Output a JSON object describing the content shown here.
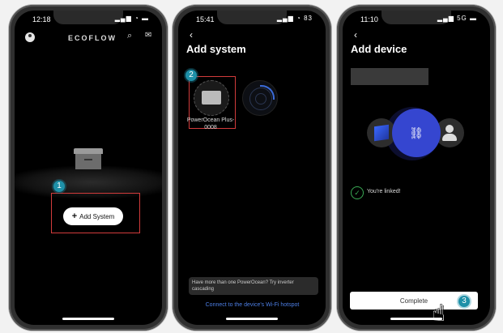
{
  "phone1": {
    "time": "12:18",
    "status": "▂▄▆ ◔ ▬",
    "logo": "ECOFLOW",
    "step_number": "1",
    "add_button": "Add System"
  },
  "phone2": {
    "time": "15:41",
    "status": "▂▄▆ ◔ 83",
    "title": "Add system",
    "step_number": "2",
    "device_name": "PowerOcean Plus-0008",
    "hint": "Have more than one PowerOcean? Try inverter cascading",
    "link": "Connect to the device's Wi-Fi hotspot"
  },
  "phone3": {
    "time": "11:10",
    "status": "▂▄▆ 5G ▬",
    "title": "Add device",
    "linked_message": "You're linked!",
    "complete_button": "Complete",
    "step_number": "3"
  },
  "colors": {
    "accent_blue": "#3546d0",
    "step_badge": "#1e90a8",
    "highlight_red": "#d23b3b",
    "link_blue": "#4d7fe6",
    "success_green": "#3aaa55"
  }
}
